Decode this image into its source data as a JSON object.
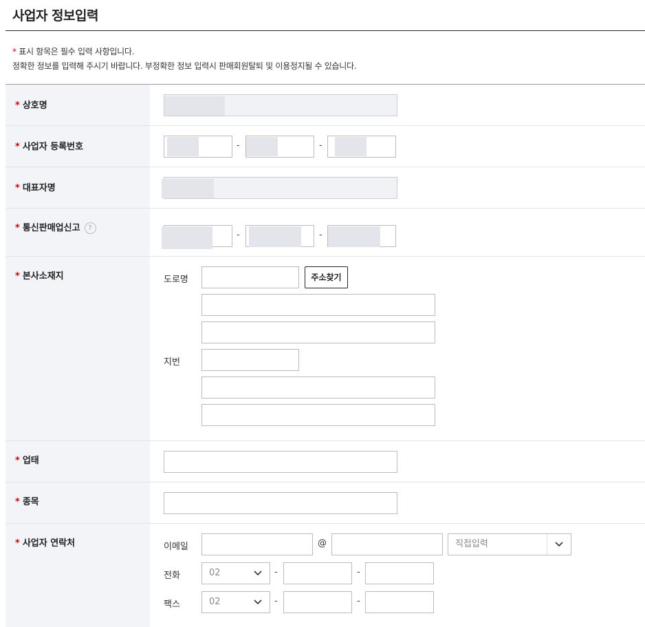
{
  "page": {
    "title": "사업자 정보입력",
    "note_star": "*",
    "note_line1": " 표시 항목은 필수 입력 사항입니다.",
    "note_line2": "정확한 정보를 입력해 주시기 바랍니다. 부정확한 정보 입력시 판매회원탈퇴 및 이용정지될 수 있습니다."
  },
  "form": {
    "required_mark": "*",
    "dash": "-",
    "business_name": {
      "label": "상호명"
    },
    "registration_number": {
      "label": "사업자 등록번호"
    },
    "representative": {
      "label": "대표자명"
    },
    "mail_order": {
      "label": "통신판매업신고",
      "help_icon": "?"
    },
    "address": {
      "label": "본사소재지",
      "road_label": "도로명",
      "search_button": "주소찾기",
      "lot_label": "지번"
    },
    "business_type": {
      "label": "업태"
    },
    "business_item": {
      "label": "종목"
    },
    "contact": {
      "label": "사업자 연락처",
      "email_label": "이메일",
      "at_sign": "@",
      "domain_select": "직접입력",
      "phone_label": "전화",
      "phone_area": "02",
      "fax_label": "팩스",
      "fax_area": "02"
    }
  },
  "icons": {
    "help": "question-circle-icon",
    "select_arrow": "chevron-down-icon"
  },
  "colors": {
    "required": "#dd0000",
    "header_bg": "#f3f4f7",
    "input_border": "#bbbbbb"
  }
}
